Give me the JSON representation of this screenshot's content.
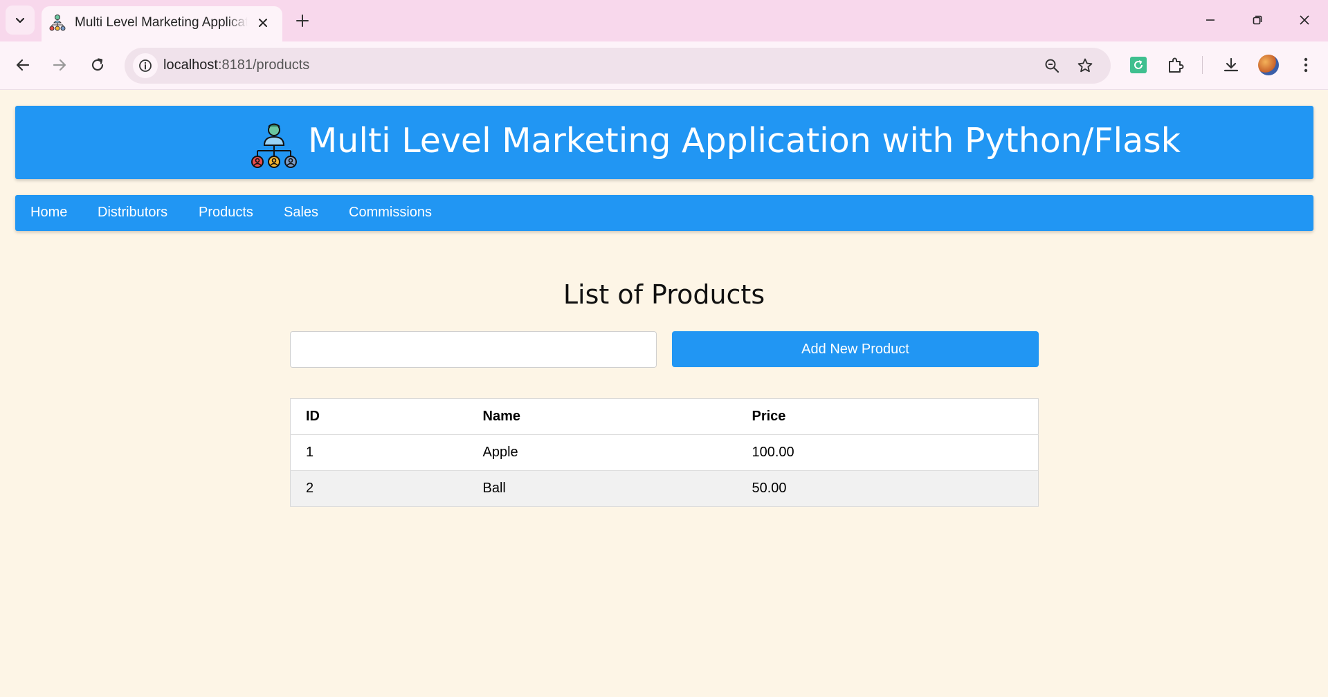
{
  "browser": {
    "tab_title": "Multi Level Marketing Application with Python/Flask",
    "url_host": "localhost",
    "url_path": ":8181/products",
    "accent": "#f8d8ec"
  },
  "header": {
    "title": "Multi Level Marketing Application with Python/Flask",
    "background": "#2196f3"
  },
  "nav": {
    "items": [
      {
        "label": "Home"
      },
      {
        "label": "Distributors"
      },
      {
        "label": "Products"
      },
      {
        "label": "Sales"
      },
      {
        "label": "Commissions"
      }
    ]
  },
  "main": {
    "heading": "List of Products",
    "search": {
      "value": "",
      "placeholder": ""
    },
    "add_button_label": "Add New Product",
    "table": {
      "columns": [
        "ID",
        "Name",
        "Price"
      ],
      "rows": [
        [
          "1",
          "Apple",
          "100.00"
        ],
        [
          "2",
          "Ball",
          "50.00"
        ]
      ]
    }
  }
}
